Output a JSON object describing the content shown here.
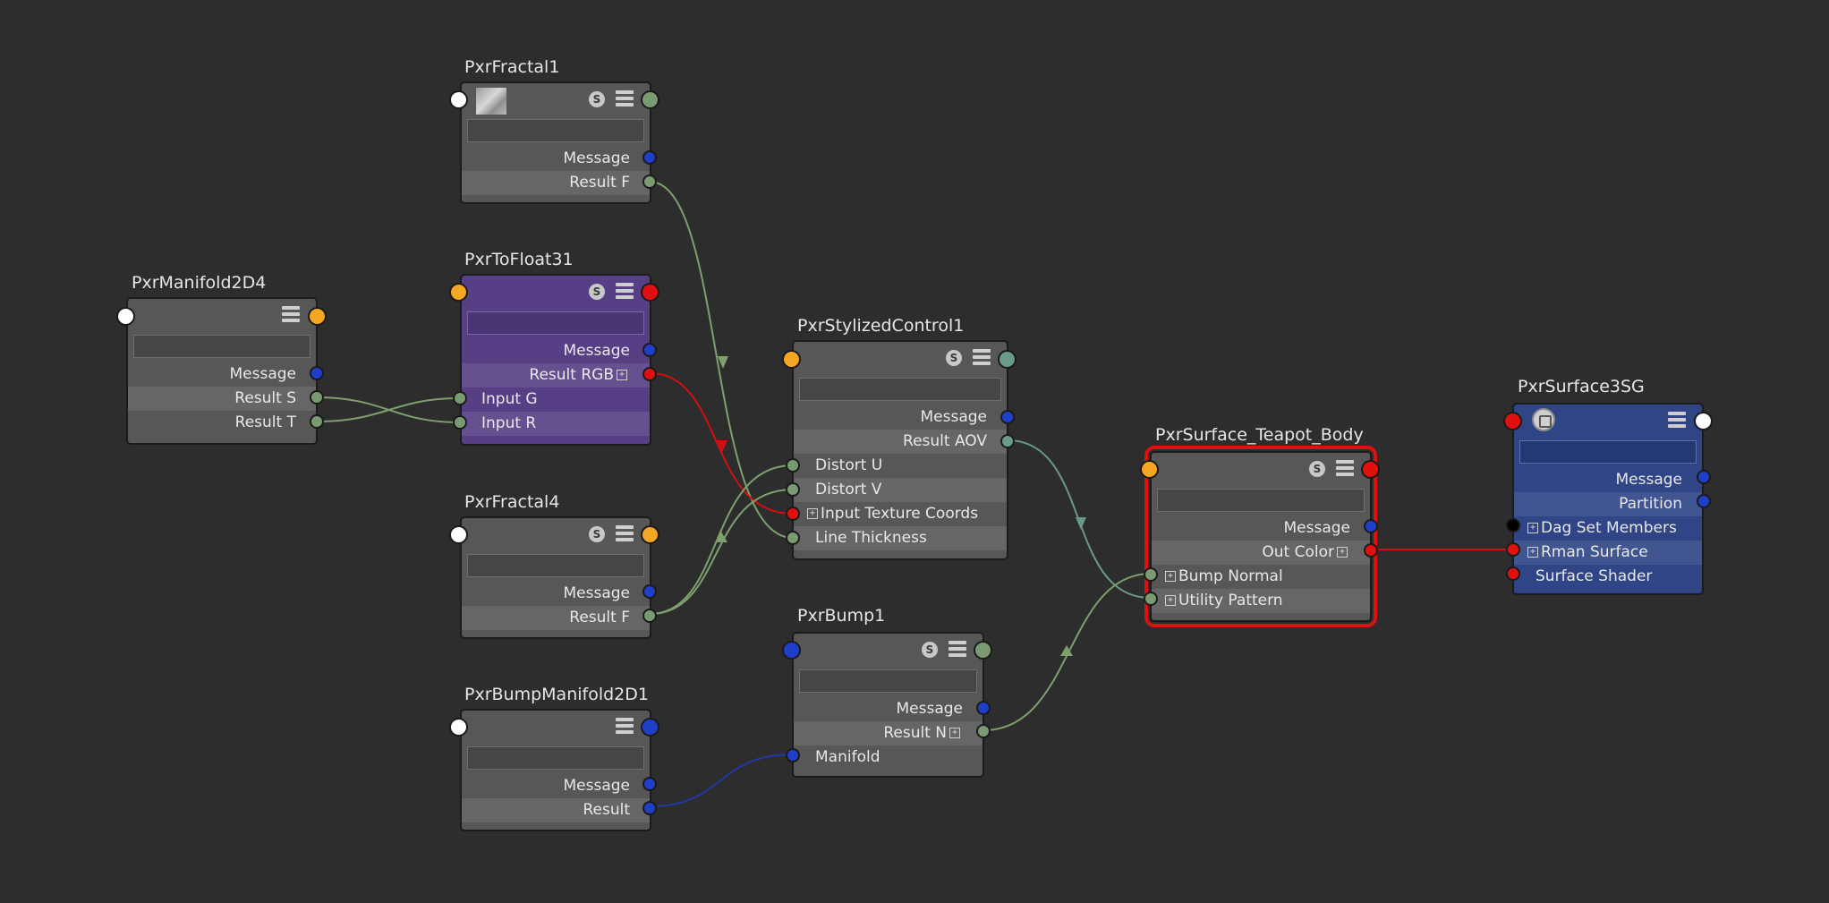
{
  "colors": {
    "background": "#2d2d2d",
    "node_gray": "#575757",
    "node_purple": "#563f85",
    "node_blue": "#2f4585",
    "selection": "#e01010",
    "port_orange": "#f5a623",
    "port_red": "#e01010",
    "port_green": "#7a9a72",
    "port_teal": "#6a9a8c",
    "port_blue": "#1f3fc8",
    "port_white": "#ffffff",
    "wire_green": "#7ea06e",
    "wire_teal": "#6a988a",
    "wire_red": "#d01010",
    "wire_blue": "#2238a8"
  },
  "nodes": {
    "pxrFractal1": {
      "title": "PxrFractal1",
      "icons": [
        "texture-thumbnail",
        "solo-s-icon",
        "attribute-list-icon"
      ],
      "outputs": [
        "Message",
        "Result F"
      ]
    },
    "pxrToFloat31": {
      "title": "PxrToFloat31",
      "icons": [
        "solo-s-icon",
        "attribute-list-icon"
      ],
      "outputs": [
        "Message",
        "Result RGB"
      ],
      "inputs": [
        "Input G",
        "Input R"
      ]
    },
    "pxrManifold2D4": {
      "title": "PxrManifold2D4",
      "icons": [
        "attribute-list-icon"
      ],
      "outputs": [
        "Message",
        "Result S",
        "Result T"
      ]
    },
    "pxrFractal4": {
      "title": "PxrFractal4",
      "icons": [
        "solo-s-icon",
        "attribute-list-icon"
      ],
      "outputs": [
        "Message",
        "Result F"
      ]
    },
    "pxrBumpManifold2D1": {
      "title": "PxrBumpManifold2D1",
      "icons": [
        "attribute-list-icon"
      ],
      "outputs": [
        "Message",
        "Result"
      ]
    },
    "pxrStylizedControl1": {
      "title": "PxrStylizedControl1",
      "icons": [
        "solo-s-icon",
        "attribute-list-icon"
      ],
      "outputs": [
        "Message",
        "Result AOV"
      ],
      "inputs": [
        "Distort U",
        "Distort V",
        "Input Texture Coords",
        "Line Thickness"
      ]
    },
    "pxrBump1": {
      "title": "PxrBump1",
      "icons": [
        "solo-s-icon",
        "attribute-list-icon"
      ],
      "outputs": [
        "Message",
        "Result N"
      ],
      "inputs": [
        "Manifold"
      ]
    },
    "pxrSurfaceTeapotBody": {
      "title": "PxrSurface_Teapot_Body",
      "icons": [
        "solo-s-icon",
        "attribute-list-icon"
      ],
      "outputs": [
        "Message",
        "Out Color"
      ],
      "inputs": [
        "Bump Normal",
        "Utility Pattern"
      ],
      "selected": true
    },
    "pxrSurface3SG": {
      "title": "PxrSurface3SG",
      "icons": [
        "shading-group-icon",
        "attribute-list-icon"
      ],
      "outputs": [
        "Message",
        "Partition"
      ],
      "inputs": [
        "Dag Set Members",
        "Rman Surface",
        "Surface Shader"
      ]
    }
  },
  "connections": [
    {
      "from": "PxrFractal1.Result F",
      "to": "PxrStylizedControl1.Line Thickness"
    },
    {
      "from": "PxrManifold2D4.Result S",
      "to": "PxrToFloat31.Input R"
    },
    {
      "from": "PxrManifold2D4.Result T",
      "to": "PxrToFloat31.Input G"
    },
    {
      "from": "PxrToFloat31.Result RGB",
      "to": "PxrStylizedControl1.Input Texture Coords"
    },
    {
      "from": "PxrFractal4.Result F",
      "to": "PxrStylizedControl1.Distort U"
    },
    {
      "from": "PxrFractal4.Result F",
      "to": "PxrStylizedControl1.Distort V"
    },
    {
      "from": "PxrBumpManifold2D1.Result",
      "to": "PxrBump1.Manifold"
    },
    {
      "from": "PxrStylizedControl1.Result AOV",
      "to": "PxrSurface_Teapot_Body.Utility Pattern"
    },
    {
      "from": "PxrBump1.Result N",
      "to": "PxrSurface_Teapot_Body.Bump Normal"
    },
    {
      "from": "PxrSurface_Teapot_Body.Out Color",
      "to": "PxrSurface3SG.Rman Surface"
    }
  ]
}
